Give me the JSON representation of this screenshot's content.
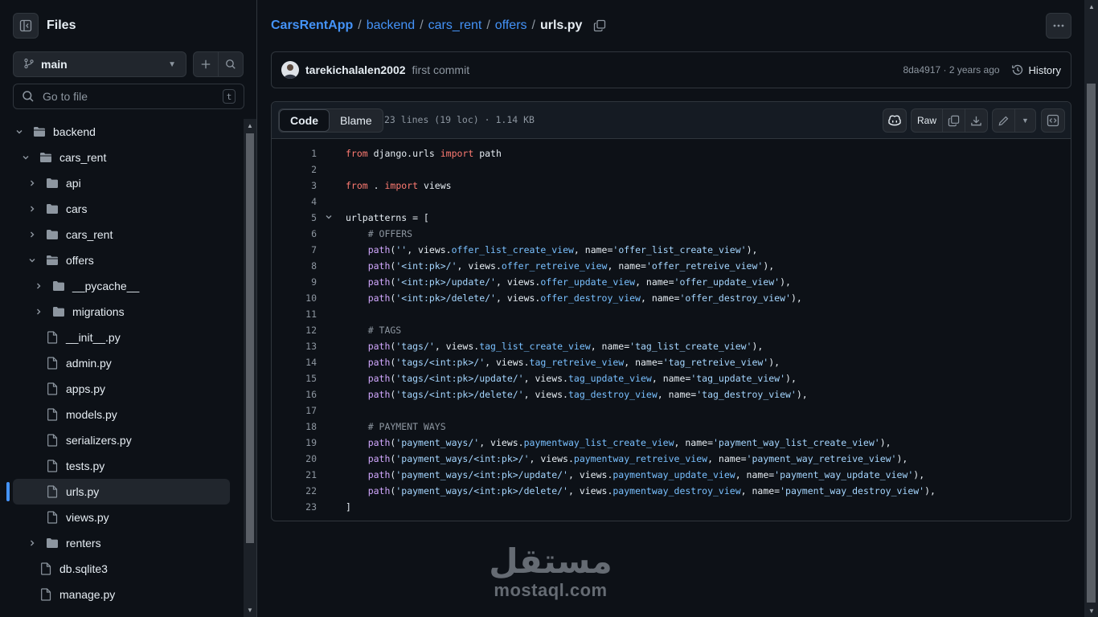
{
  "sidebar": {
    "title": "Files",
    "branch": "main",
    "goto_placeholder": "Go to file",
    "goto_shortcut": "t",
    "tree": [
      {
        "name": "backend",
        "type": "folder",
        "depth": 0,
        "expanded": true
      },
      {
        "name": "cars_rent",
        "type": "folder",
        "depth": 1,
        "expanded": true
      },
      {
        "name": "api",
        "type": "folder",
        "depth": 2,
        "expanded": false
      },
      {
        "name": "cars",
        "type": "folder",
        "depth": 2,
        "expanded": false
      },
      {
        "name": "cars_rent",
        "type": "folder",
        "depth": 2,
        "expanded": false
      },
      {
        "name": "offers",
        "type": "folder",
        "depth": 2,
        "expanded": true
      },
      {
        "name": "__pycache__",
        "type": "folder",
        "depth": 3,
        "expanded": false
      },
      {
        "name": "migrations",
        "type": "folder",
        "depth": 3,
        "expanded": false
      },
      {
        "name": "__init__.py",
        "type": "file",
        "depth": 3
      },
      {
        "name": "admin.py",
        "type": "file",
        "depth": 3
      },
      {
        "name": "apps.py",
        "type": "file",
        "depth": 3
      },
      {
        "name": "models.py",
        "type": "file",
        "depth": 3
      },
      {
        "name": "serializers.py",
        "type": "file",
        "depth": 3
      },
      {
        "name": "tests.py",
        "type": "file",
        "depth": 3
      },
      {
        "name": "urls.py",
        "type": "file",
        "depth": 3,
        "active": true
      },
      {
        "name": "views.py",
        "type": "file",
        "depth": 3
      },
      {
        "name": "renters",
        "type": "folder",
        "depth": 2,
        "expanded": false
      },
      {
        "name": "db.sqlite3",
        "type": "file",
        "depth": 2
      },
      {
        "name": "manage.py",
        "type": "file",
        "depth": 2
      }
    ]
  },
  "breadcrumb": {
    "repo": "CarsRentApp",
    "parts": [
      "backend",
      "cars_rent",
      "offers"
    ],
    "current": "urls.py"
  },
  "commit": {
    "author": "tarekichalalen2002",
    "message": "first commit",
    "meta": "8da4917 · 2 years ago",
    "history_label": "History"
  },
  "file": {
    "tabs": [
      "Code",
      "Blame"
    ],
    "active_tab": "Code",
    "info": "23 lines (19 loc) · 1.14 KB",
    "raw_label": "Raw",
    "lines": [
      "from django.urls import path",
      "",
      "from . import views",
      "",
      "urlpatterns = [",
      "    # OFFERS",
      "    path('', views.offer_list_create_view, name='offer_list_create_view'),",
      "    path('<int:pk>/', views.offer_retreive_view, name='offer_retreive_view'),",
      "    path('<int:pk>/update/', views.offer_update_view, name='offer_update_view'),",
      "    path('<int:pk>/delete/', views.offer_destroy_view, name='offer_destroy_view'),",
      "",
      "    # TAGS",
      "    path('tags/', views.tag_list_create_view, name='tag_list_create_view'),",
      "    path('tags/<int:pk>/', views.tag_retreive_view, name='tag_retreive_view'),",
      "    path('tags/<int:pk>/update/', views.tag_update_view, name='tag_update_view'),",
      "    path('tags/<int:pk>/delete/', views.tag_destroy_view, name='tag_destroy_view'),",
      "",
      "    # PAYMENT WAYS",
      "    path('payment_ways/', views.paymentway_list_create_view, name='payment_way_list_create_view'),",
      "    path('payment_ways/<int:pk>/', views.paymentway_retreive_view, name='payment_way_retreive_view'),",
      "    path('payment_ways/<int:pk>/update/', views.paymentway_update_view, name='payment_way_update_view'),",
      "    path('payment_ways/<int:pk>/delete/', views.paymentway_destroy_view, name='payment_way_destroy_view'),",
      "]"
    ]
  },
  "watermark": {
    "arabic": "مستقل",
    "latin": "mostaql.com"
  },
  "colors": {
    "background": "#0d1117",
    "border": "#30363d",
    "link": "#4493f8",
    "muted": "#8d96a0",
    "keyword": "#ff7b72",
    "string": "#a5d6ff",
    "function": "#d2a8ff",
    "attribute": "#79c0ff",
    "comment": "#8d96a0",
    "folder_icon": "#8d96a0"
  },
  "icons": {
    "sidebar_toggle": "sidebar-collapse-icon",
    "branch": "git-branch-icon",
    "add": "plus-icon",
    "search": "search-icon",
    "copy": "copy-icon",
    "more": "kebab-horizontal-icon",
    "history": "history-icon",
    "copilot": "copilot-icon",
    "download": "download-icon",
    "edit": "pencil-icon",
    "symbols": "code-square-icon",
    "folder": "folder-icon",
    "file": "file-icon"
  }
}
